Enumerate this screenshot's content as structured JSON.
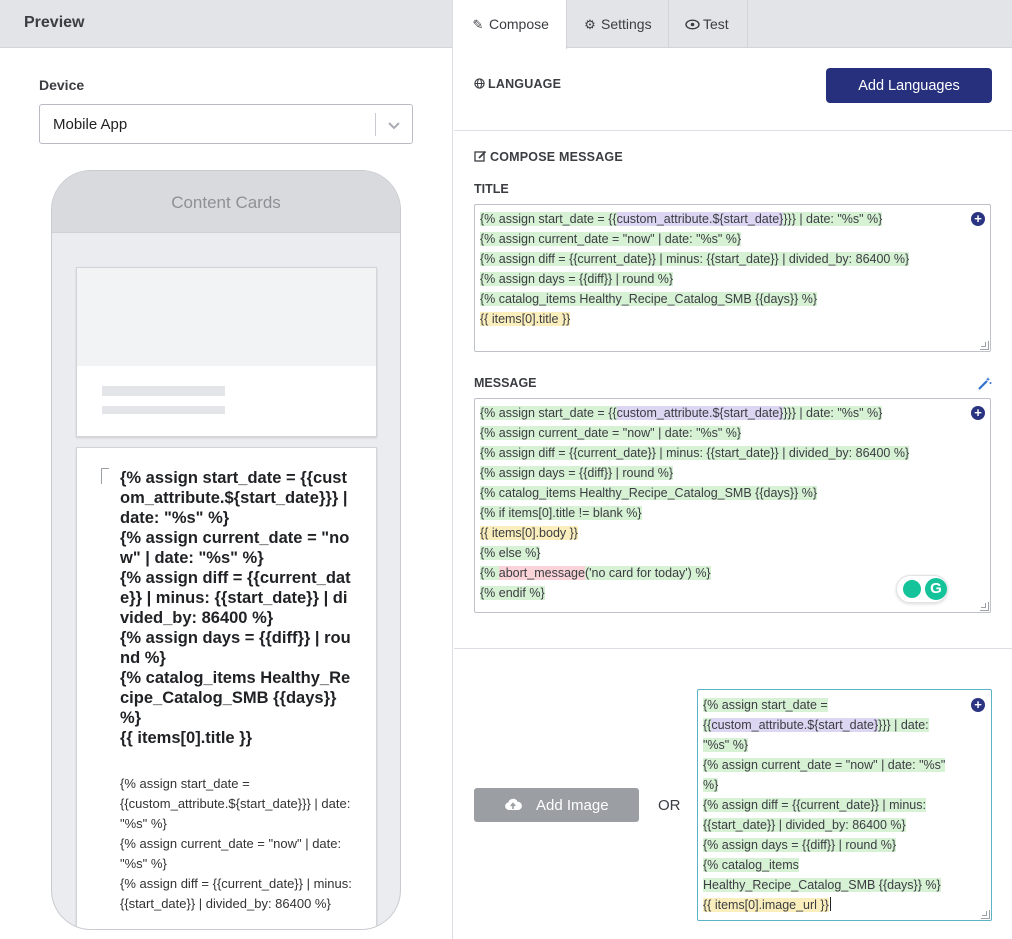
{
  "preview": {
    "header": "Preview",
    "device_label": "Device",
    "device_value": "Mobile App",
    "phone_header": "Content Cards",
    "card_title_lines": [
      "{% assign start_date = {{custom_attribute.${start_date}}} | date: \"%s\" %}",
      "{% assign current_date = \"now\" | date: \"%s\" %}",
      "{% assign diff = {{current_date}} | minus: {{start_date}} | divided_by: 86400 %}",
      "{% assign days = {{diff}} | round %}",
      "{% catalog_items Healthy_Recipe_Catalog_SMB {{days}} %}",
      "{{ items[0].title }}"
    ],
    "card_body_lines": [
      "{% assign start_date = {{custom_attribute.${start_date}}} | date: \"%s\" %}",
      "{% assign current_date = \"now\" | date: \"%s\" %}",
      "{% assign diff = {{current_date}} | minus: {{start_date}} | divided_by: 86400 %}"
    ]
  },
  "tabs": [
    {
      "label": "Compose",
      "icon": "pencil-icon"
    },
    {
      "label": "Settings",
      "icon": "gear-icon"
    },
    {
      "label": "Test",
      "icon": "eye-icon"
    }
  ],
  "language": {
    "heading": "LANGUAGE",
    "icon": "globe-icon",
    "add_button": "Add Languages"
  },
  "compose": {
    "heading": "COMPOSE MESSAGE",
    "icon": "edit-icon",
    "title_label": "TITLE",
    "title_lines": [
      [
        [
          "{% assign start_date = {{",
          "g"
        ],
        [
          "custom_attribute.${start_date}",
          "p"
        ],
        [
          "}}} | date: \"%s\" %}",
          "g"
        ]
      ],
      [
        [
          "{% assign current_date = \"now\" | date: \"%s\" %}",
          "g"
        ]
      ],
      [
        [
          "{% assign diff = {{current_date}} | minus: {{start_date}} | divided_by: 86400 %}",
          "g"
        ]
      ],
      [
        [
          "{% assign days = {{diff}} | round %}",
          "g"
        ]
      ],
      [
        [
          "{% catalog_items Healthy_Recipe_Catalog_SMB {{days}} %}",
          "g"
        ]
      ],
      [
        [
          "{{ items[0].title }}",
          "y"
        ]
      ]
    ],
    "message_label": "MESSAGE",
    "message_lines": [
      [
        [
          "{% assign start_date = {{",
          "g"
        ],
        [
          "custom_attribute.${start_date}",
          "p"
        ],
        [
          "}}} | date: \"%s\" %}",
          "g"
        ]
      ],
      [
        [
          "{% assign current_date = \"now\" | date: \"%s\" %}",
          "g"
        ]
      ],
      [
        [
          "{% assign diff = {{current_date}} | minus: {{start_date}} | divided_by: 86400 %}",
          "g"
        ]
      ],
      [
        [
          "{% assign days = {{diff}} | round %}",
          "g"
        ]
      ],
      [
        [
          "{% catalog_items Healthy_Recipe_Catalog_SMB {{days}} %}",
          "g"
        ]
      ],
      [
        [
          "{% if items[0].title != blank %}",
          "g"
        ]
      ],
      [
        [
          "{{ items[0].body }}",
          "y"
        ]
      ],
      [
        [
          "{% else %}",
          "g"
        ]
      ],
      [
        [
          "{% ",
          "g"
        ],
        [
          "abort_message",
          "r"
        ],
        [
          "('no card for today') %}",
          "g"
        ]
      ],
      [
        [
          "{% endif %}",
          "g"
        ]
      ]
    ]
  },
  "image": {
    "add_button": "Add Image",
    "or_text": "OR",
    "url_lines": [
      [
        [
          "{% assign start_date = ",
          "g"
        ]
      ],
      [
        [
          "{{",
          "g"
        ],
        [
          "custom_attribute.${start_date}",
          "p"
        ],
        [
          "}}} | date: ",
          "g"
        ]
      ],
      [
        [
          "\"%s\" %}",
          "g"
        ]
      ],
      [
        [
          "{% assign current_date = \"now\" | date: \"%s\" ",
          "g"
        ]
      ],
      [
        [
          "%}",
          "g"
        ]
      ],
      [
        [
          "{% assign diff = {{current_date}} | minus: ",
          "g"
        ]
      ],
      [
        [
          "{{start_date}} | divided_by: 86400 %}",
          "g"
        ]
      ],
      [
        [
          "{% assign days = {{diff}} | round %}",
          "g"
        ]
      ],
      [
        [
          "{% catalog_items ",
          "g"
        ]
      ],
      [
        [
          "Healthy_Recipe_Catalog_SMB {{days}} %}",
          "g"
        ]
      ],
      [
        [
          "{{ items[0].image_url }}",
          "y"
        ]
      ]
    ]
  },
  "colors": {
    "accent": "#26307d",
    "highlight_green": "#d7f1d5",
    "highlight_purple": "#ddd6f3",
    "highlight_yellow": "#fbeebd",
    "highlight_red": "#f9d3d7",
    "focus_border": "#5ab4c5"
  }
}
